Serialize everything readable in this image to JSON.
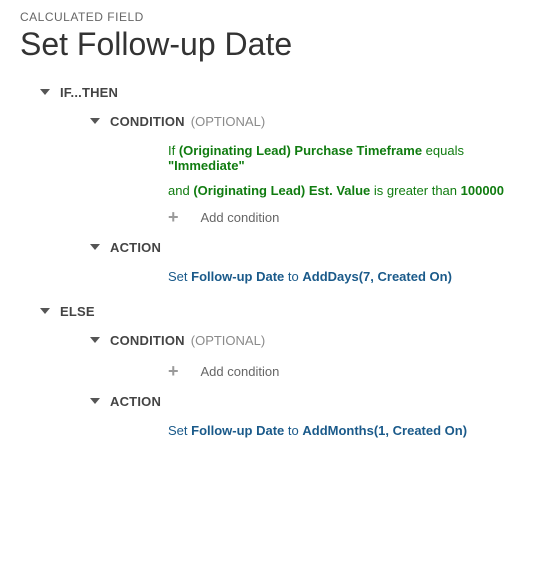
{
  "header": {
    "breadcrumb": "CALCULATED FIELD",
    "title": "Set Follow-up Date"
  },
  "ifthen": {
    "label": "IF...THEN",
    "condition": {
      "label": "CONDITION",
      "optional": "(OPTIONAL)",
      "line1": {
        "p1": "If ",
        "field": "(Originating Lead) Purchase Timeframe",
        "op": " equals ",
        "val": "\"Immediate\""
      },
      "line2": {
        "p1": "and ",
        "field": "(Originating Lead) Est. Value",
        "op": " is greater than ",
        "val": "100000"
      },
      "add": "Add condition"
    },
    "action": {
      "label": "ACTION",
      "line": {
        "p1": "Set ",
        "field": "Follow-up Date",
        "to": " to ",
        "func": "AddDays(7, Created On)"
      }
    }
  },
  "else": {
    "label": "ELSE",
    "condition": {
      "label": "CONDITION",
      "optional": "(OPTIONAL)",
      "add": "Add condition"
    },
    "action": {
      "label": "ACTION",
      "line": {
        "p1": "Set ",
        "field": "Follow-up Date",
        "to": " to ",
        "func": "AddMonths(1, Created On)"
      }
    }
  }
}
